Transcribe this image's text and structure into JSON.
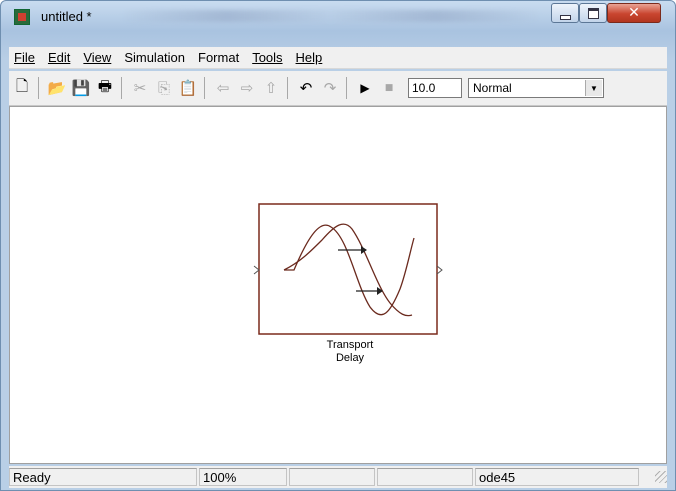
{
  "window": {
    "title": "untitled *"
  },
  "menu": {
    "items": [
      "File",
      "Edit",
      "View",
      "Simulation",
      "Format",
      "Tools",
      "Help"
    ],
    "accelerators": [
      "F",
      "E",
      "V",
      "S",
      "o",
      "T",
      "H"
    ]
  },
  "toolbar": {
    "icons": [
      "new-model-icon",
      "open-icon",
      "save-icon",
      "print-icon",
      "cut-icon",
      "copy-icon",
      "paste-icon",
      "back-icon",
      "forward-icon",
      "up-icon",
      "undo-icon",
      "redo-icon",
      "run-icon",
      "stop-icon"
    ],
    "stop_time": "10.0",
    "sim_mode": "Normal"
  },
  "block": {
    "label_line1": "Transport",
    "label_line2": "Delay",
    "line_color": "#7a2a1c"
  },
  "status": {
    "state": "Ready",
    "zoom": "100%",
    "cell3": "",
    "cell4": "",
    "solver": "ode45"
  }
}
